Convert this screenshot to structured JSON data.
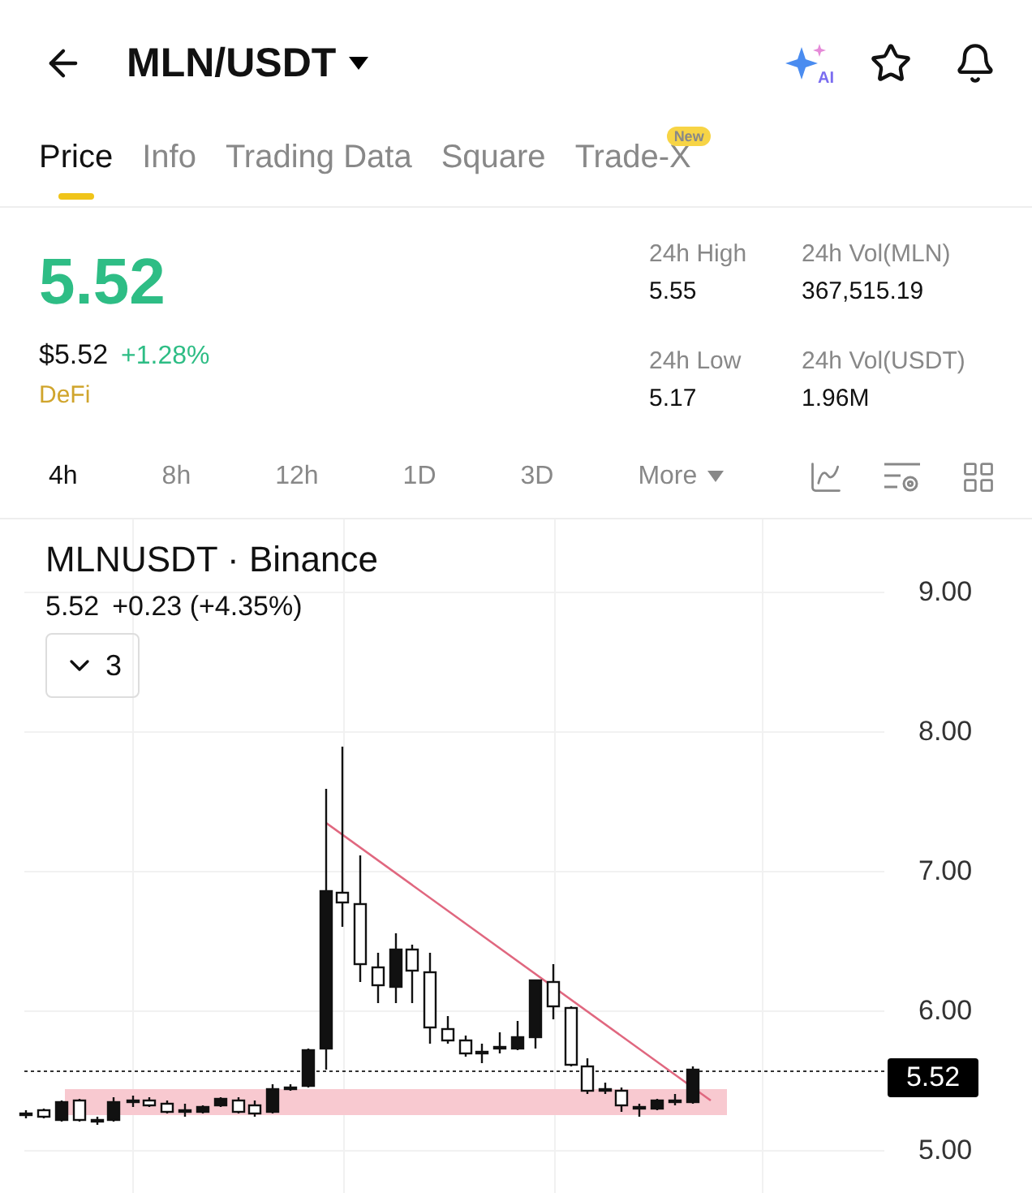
{
  "header": {
    "pair": "MLN/USDT",
    "ai_badge": "AI"
  },
  "tabs": [
    {
      "label": "Price",
      "selected": true
    },
    {
      "label": "Info",
      "selected": false
    },
    {
      "label": "Trading Data",
      "selected": false
    },
    {
      "label": "Square",
      "selected": false
    },
    {
      "label": "Trade-X",
      "selected": false,
      "badge": "New"
    }
  ],
  "price": {
    "last": "5.52",
    "usd": "$5.52",
    "change": "+1.28%",
    "category": "DeFi"
  },
  "stats": [
    {
      "label": "24h High",
      "value": "5.55"
    },
    {
      "label": "24h Vol(MLN)",
      "value": "367,515.19"
    },
    {
      "label": "24h Low",
      "value": "5.17"
    },
    {
      "label": "24h Vol(USDT)",
      "value": "1.96M"
    }
  ],
  "intervals": [
    {
      "label": "4h",
      "selected": true
    },
    {
      "label": "8h",
      "selected": false
    },
    {
      "label": "12h",
      "selected": false
    },
    {
      "label": "1D",
      "selected": false
    },
    {
      "label": "3D",
      "selected": false
    },
    {
      "label": "More",
      "selected": false
    }
  ],
  "chart": {
    "symbol": "MLNUSDT · Binance",
    "last": "5.52",
    "change": "+0.23 (+4.35%)",
    "indicator_count": "3",
    "axis_labels": [
      "9.00",
      "8.00",
      "7.00",
      "6.00",
      "5.00"
    ],
    "price_tag": "5.52"
  }
}
